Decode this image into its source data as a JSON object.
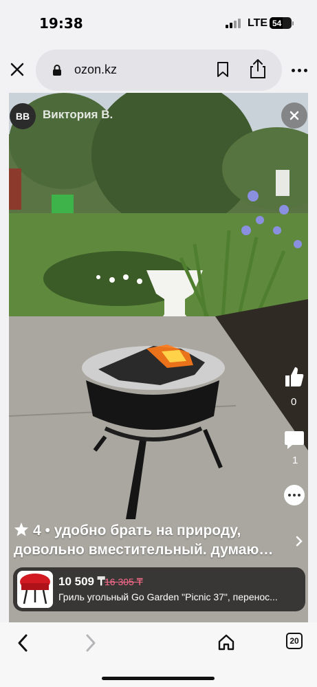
{
  "status": {
    "time": "19:38",
    "network": "LTE",
    "battery": "54"
  },
  "browser": {
    "url": "ozon.kz",
    "tabs_count": "20"
  },
  "photo_overlay": {
    "author_initials": "ВВ",
    "author_name": "Виктория В."
  },
  "reactions": {
    "likes": "0",
    "comments": "1"
  },
  "review": {
    "rating": "4",
    "line1": "4 • удобно брать на природу,",
    "line2": "довольно вместительный. думаю…"
  },
  "product": {
    "price": "10 509 ₸",
    "old_price": "16 305 ₸",
    "title": "Гриль угольный Go Garden \"Picnic 37\", перенос..."
  },
  "icons": {
    "close": "close-icon",
    "lock": "lock-icon",
    "bookmark": "bookmark-icon",
    "share": "share-icon",
    "more": "more-icon",
    "like": "thumbs-up-icon",
    "comment": "comment-icon",
    "star": "star-icon",
    "back": "back-icon",
    "forward": "forward-icon",
    "home": "home-icon"
  }
}
